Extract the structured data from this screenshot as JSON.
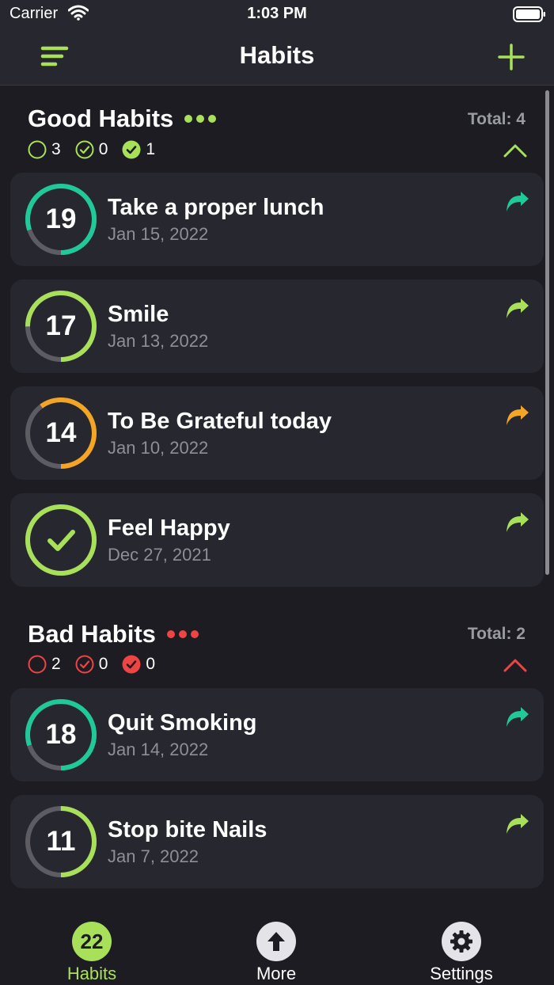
{
  "status_bar": {
    "carrier": "Carrier",
    "time": "1:03 PM"
  },
  "nav": {
    "title": "Habits",
    "menu_icon": "menu-icon",
    "add_icon": "plus-icon"
  },
  "colors": {
    "green": "#a8e05a",
    "teal": "#1fc99a",
    "orange": "#f5a524",
    "red": "#ef4444",
    "gray": "#5c5c62"
  },
  "good_section": {
    "title": "Good Habits",
    "total": "Total: 4",
    "stats": {
      "pending": "3",
      "checked": "0",
      "done": "1"
    },
    "habits": [
      {
        "count": "19",
        "name": "Take a proper lunch",
        "date": "Jan 15, 2022",
        "progress": 0.8,
        "color": "#1fc99a"
      },
      {
        "count": "17",
        "name": "Smile",
        "date": "Jan 13, 2022",
        "progress": 0.75,
        "color": "#a8e05a"
      },
      {
        "count": "14",
        "name": "To Be Grateful today",
        "date": "Jan 10, 2022",
        "progress": 0.6,
        "color": "#f5a524"
      },
      {
        "count": "",
        "name": "Feel Happy",
        "date": "Dec 27, 2021",
        "progress": 1.0,
        "color": "#a8e05a"
      }
    ]
  },
  "bad_section": {
    "title": "Bad Habits",
    "total": "Total: 2",
    "stats": {
      "pending": "2",
      "checked": "0",
      "done": "0"
    },
    "habits": [
      {
        "count": "18",
        "name": "Quit Smoking",
        "date": "Jan 14, 2022",
        "progress": 0.8,
        "color": "#1fc99a"
      },
      {
        "count": "11",
        "name": "Stop bite Nails",
        "date": "Jan 7, 2022",
        "progress": 0.5,
        "color": "#a8e05a"
      }
    ]
  },
  "tabs": [
    {
      "badge": "22",
      "label": "Habits",
      "active": true
    },
    {
      "label": "More",
      "icon": "arrow-up-icon"
    },
    {
      "label": "Settings",
      "icon": "gear-icon"
    }
  ]
}
